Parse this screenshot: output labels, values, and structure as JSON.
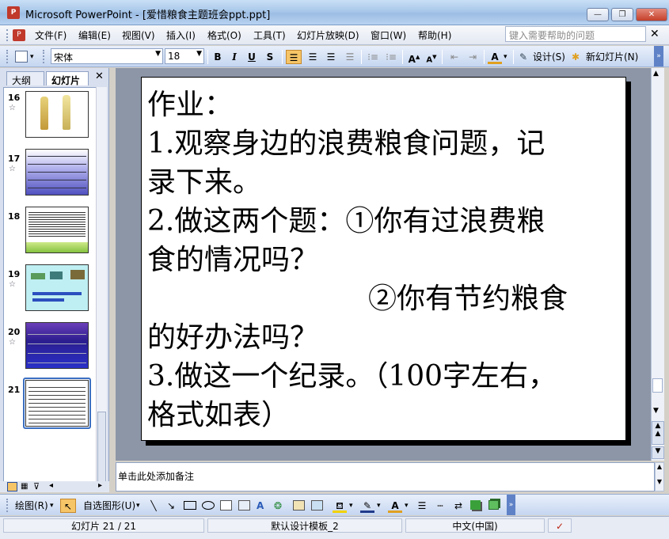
{
  "window": {
    "title": "Microsoft PowerPoint - [爱惜粮食主题班会ppt.ppt]",
    "app_icon": "powerpoint-icon"
  },
  "menu": {
    "items": [
      "文件(F)",
      "编辑(E)",
      "视图(V)",
      "插入(I)",
      "格式(O)",
      "工具(T)",
      "幻灯片放映(D)",
      "窗口(W)",
      "帮助(H)"
    ],
    "help_placeholder": "键入需要帮助的问题"
  },
  "toolbar": {
    "font_name": "宋体",
    "font_size": "18",
    "bold": "B",
    "italic": "I",
    "underline": "U",
    "shadow": "S",
    "design_label": "设计(S)",
    "new_slide_label": "新幻灯片(N)"
  },
  "left_panel": {
    "tabs": [
      "大纲",
      "幻灯片"
    ],
    "thumbnails": [
      {
        "number": "16"
      },
      {
        "number": "17"
      },
      {
        "number": "18"
      },
      {
        "number": "19"
      },
      {
        "number": "20"
      },
      {
        "number": "21"
      }
    ]
  },
  "slide": {
    "lines": [
      "作业：",
      "1.观察身边的浪费粮食问题，记",
      "录下来。",
      "2.做这两个题：①你有过浪费粮",
      "食的情况吗？",
      "②你有节约粮食",
      "的好办法吗？",
      "3.做这一个纪录。（100字左右，",
      "格式如表）"
    ]
  },
  "notes": {
    "placeholder": "单击此处添加备注"
  },
  "drawing_toolbar": {
    "draw_label": "绘图(R)",
    "autoshapes_label": "自选图形(U)"
  },
  "status": {
    "slide_position": "幻灯片 21 / 21",
    "template": "默认设计模板_2",
    "language": "中文(中国)"
  }
}
